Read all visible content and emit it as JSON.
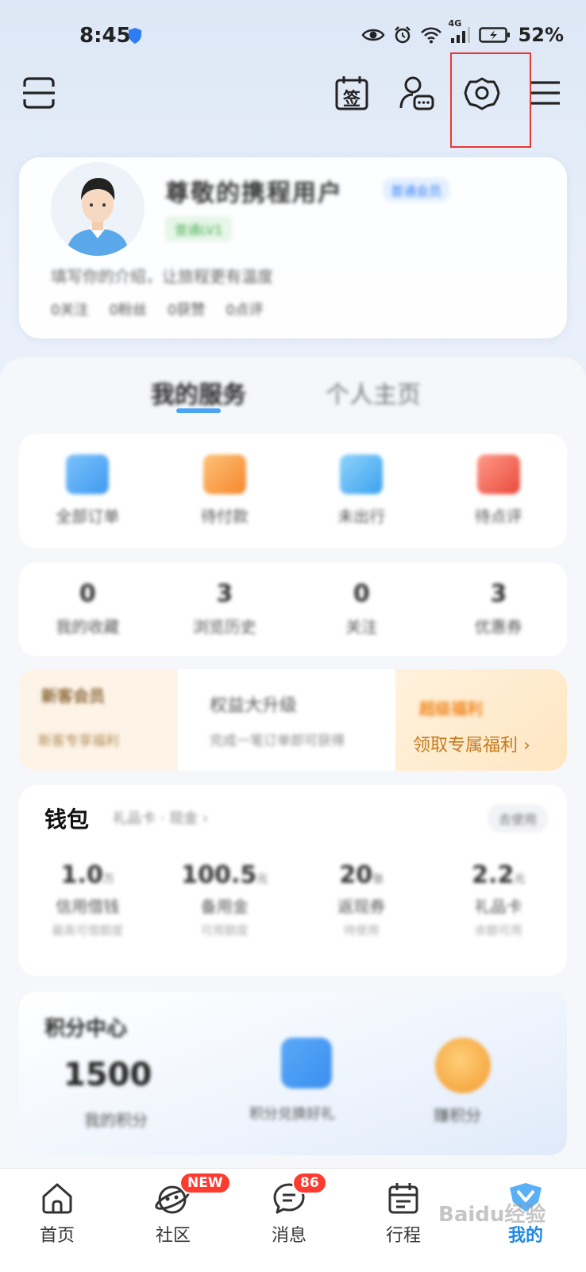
{
  "status_bar": {
    "time": "8:45",
    "network": "4G",
    "battery": "52%"
  },
  "profile": {
    "username": "尊敬的携程用户",
    "vip_tag": "普通会员",
    "level_tag": "普通LV1",
    "bio": "填写你的介绍，让旅程更有温度",
    "stats": [
      "0关注",
      "0粉丝",
      "0获赞",
      "0点评"
    ]
  },
  "tabs": [
    "我的服务",
    "个人主页"
  ],
  "orders": [
    "全部订单",
    "待付款",
    "未出行",
    "待点评"
  ],
  "counts": [
    {
      "value": "0",
      "label": "我的收藏"
    },
    {
      "value": "3",
      "label": "浏览历史"
    },
    {
      "value": "0",
      "label": "关注"
    },
    {
      "value": "3",
      "label": "优惠券"
    }
  ],
  "promo": {
    "left_title": "新客会员",
    "left_sub": "新客专享福利",
    "middle_title": "权益大升级",
    "middle_sub": "完成一笔订单即可获得",
    "right_title": "超级福利",
    "right_link": "领取专属福利",
    "right_chevron": "›"
  },
  "wallet": {
    "title": "钱包",
    "subtitle": "礼品卡 · 现金 ›",
    "button": "去使用",
    "items": [
      {
        "value": "1.0",
        "unit": "万",
        "label": "信用借钱",
        "sub": "最高可借额度"
      },
      {
        "value": "100.5",
        "unit": "元",
        "label": "备用金",
        "sub": "可用额度"
      },
      {
        "value": "20",
        "unit": "张",
        "label": "返现券",
        "sub": "待使用"
      },
      {
        "value": "2.2",
        "unit": "元",
        "label": "礼品卡",
        "sub": "余额可用"
      }
    ]
  },
  "points": {
    "title": "积分中心",
    "value": "1500",
    "label": "我的积分",
    "item1_label": "积分兑换好礼",
    "item2_label": "赚积分"
  },
  "bottom_nav": [
    {
      "label": "首页",
      "icon": "home-icon"
    },
    {
      "label": "社区",
      "icon": "community-icon",
      "badge": "NEW"
    },
    {
      "label": "消息",
      "icon": "message-icon",
      "badge": "86"
    },
    {
      "label": "行程",
      "icon": "calendar-icon"
    },
    {
      "label": "我的",
      "icon": "profile-icon"
    }
  ],
  "toolbar": {
    "sign_label": "签"
  },
  "watermark": "Baidu经验"
}
